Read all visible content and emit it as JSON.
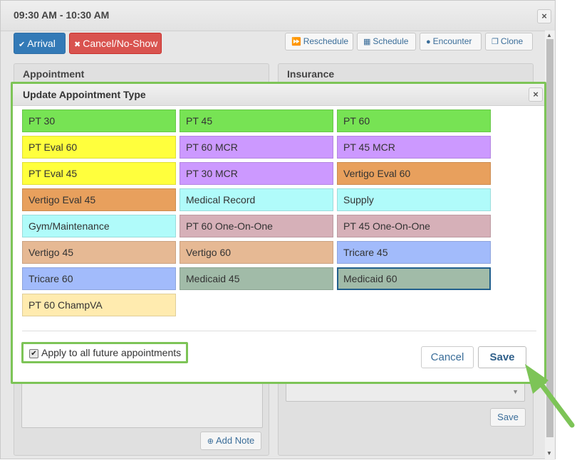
{
  "background": {
    "title": "09:30 AM - 10:30 AM",
    "close_icon": "×",
    "arrival_label": "Arrival",
    "cancel_noshow_label": "Cancel/No-Show",
    "reschedule_label": "Reschedule",
    "schedule_label": "Schedule",
    "encounter_label": "Encounter",
    "clone_label": "Clone",
    "appointment_heading": "Appointment",
    "insurance_heading": "Insurance",
    "add_note_label": "Add Note",
    "insurance_save_label": "Save"
  },
  "modal": {
    "title": "Update Appointment Type",
    "close_icon": "×",
    "types": [
      {
        "label": "PT 30",
        "color": "#77e354"
      },
      {
        "label": "PT 45",
        "color": "#77e354"
      },
      {
        "label": "PT 60",
        "color": "#77e354"
      },
      {
        "label": "PT Eval 60",
        "color": "#ffff3d"
      },
      {
        "label": "PT 60 MCR",
        "color": "#cc99ff"
      },
      {
        "label": "PT 45 MCR",
        "color": "#cc99ff"
      },
      {
        "label": "PT Eval 45",
        "color": "#ffff3d"
      },
      {
        "label": "PT 30 MCR",
        "color": "#cc99ff"
      },
      {
        "label": "Vertigo Eval 60",
        "color": "#e8a05d"
      },
      {
        "label": "Vertigo Eval 45",
        "color": "#e8a05d"
      },
      {
        "label": "Medical Record",
        "color": "#b0fbfa"
      },
      {
        "label": "Supply",
        "color": "#b0fbfa"
      },
      {
        "label": "Gym/Maintenance",
        "color": "#b0fbfa"
      },
      {
        "label": "PT 60 One-On-One",
        "color": "#d6b0b8"
      },
      {
        "label": "PT 45 One-On-One",
        "color": "#d6b0b8"
      },
      {
        "label": "Vertigo 45",
        "color": "#e6b994"
      },
      {
        "label": "Vertigo 60",
        "color": "#e6b994"
      },
      {
        "label": "Tricare 45",
        "color": "#a2bbfb"
      },
      {
        "label": "Tricare 60",
        "color": "#a2bbfb"
      },
      {
        "label": "Medicaid 45",
        "color": "#a1bba8"
      },
      {
        "label": "Medicaid 60",
        "color": "#a1bba8",
        "selected": true
      },
      {
        "label": "PT 60 ChampVA",
        "color": "#ffebaf"
      }
    ],
    "apply_future_label": "Apply to all future appointments",
    "apply_future_checked": true,
    "cancel_label": "Cancel",
    "save_label": "Save"
  },
  "colors": {
    "highlight_green": "#7dc457",
    "selected_border": "#215f8c",
    "primary_blue": "#337ab7",
    "danger_red": "#d9534f"
  }
}
